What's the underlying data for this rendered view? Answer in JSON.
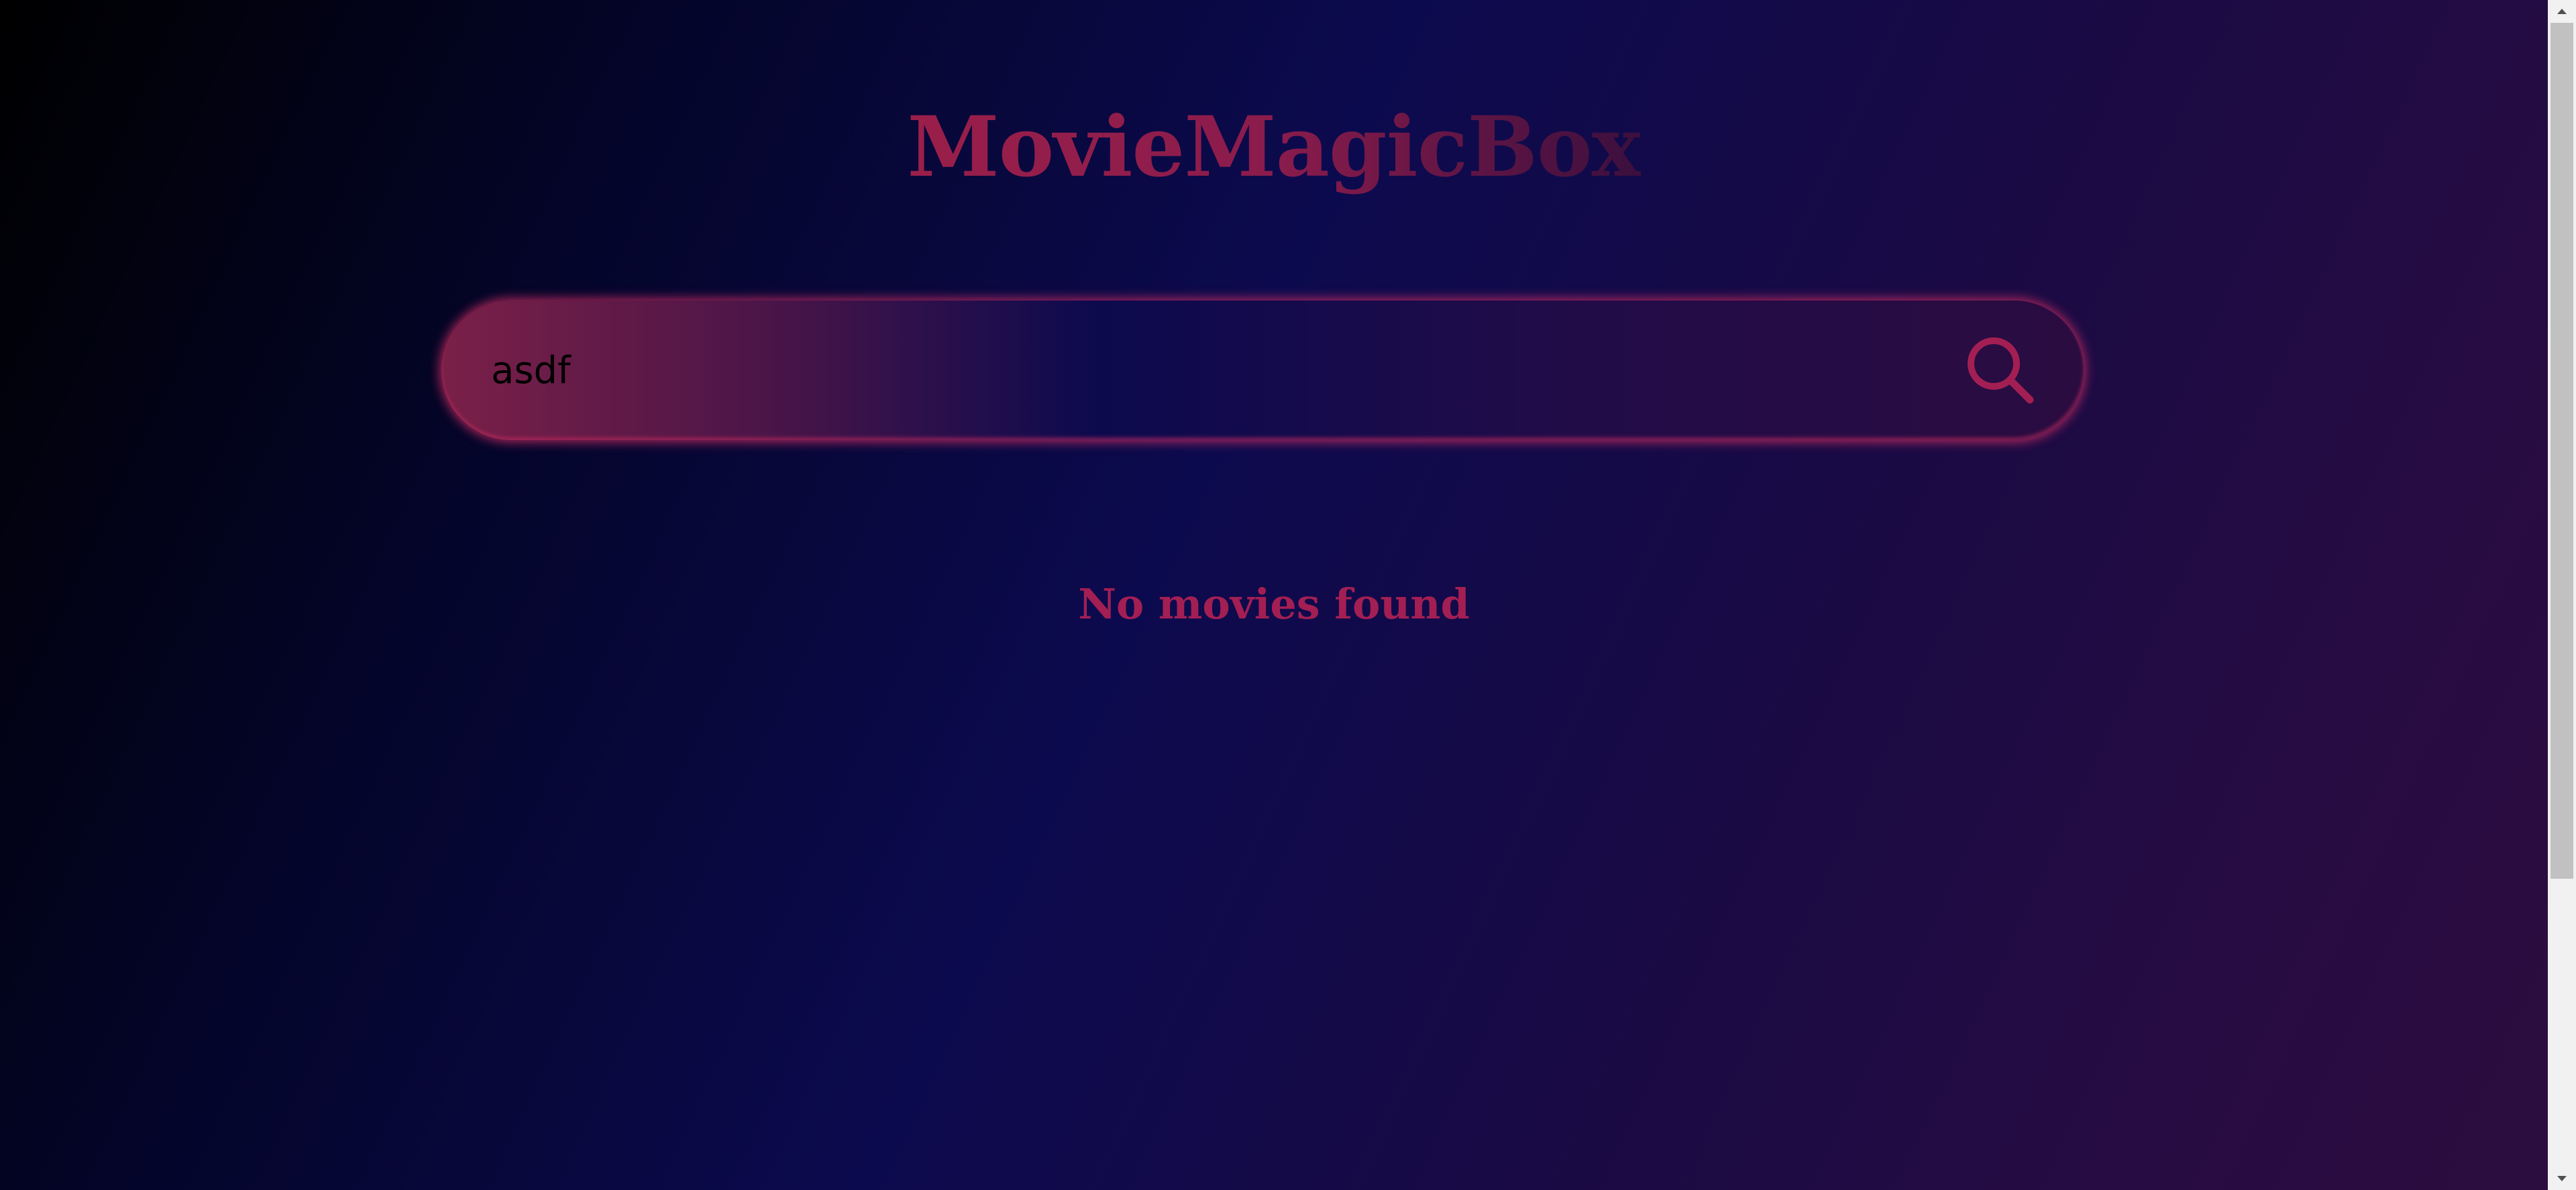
{
  "app": {
    "title": "MovieMagicBox"
  },
  "search": {
    "value": "asdf",
    "button_icon": "search-icon"
  },
  "results": {
    "empty_message": "No movies found"
  },
  "colors": {
    "accent": "#a31f53",
    "background_dark": "#000000",
    "background_mid": "#0c0a4e",
    "background_light": "#2d0d3f"
  },
  "scrollbar": {
    "position_fraction": 0
  }
}
